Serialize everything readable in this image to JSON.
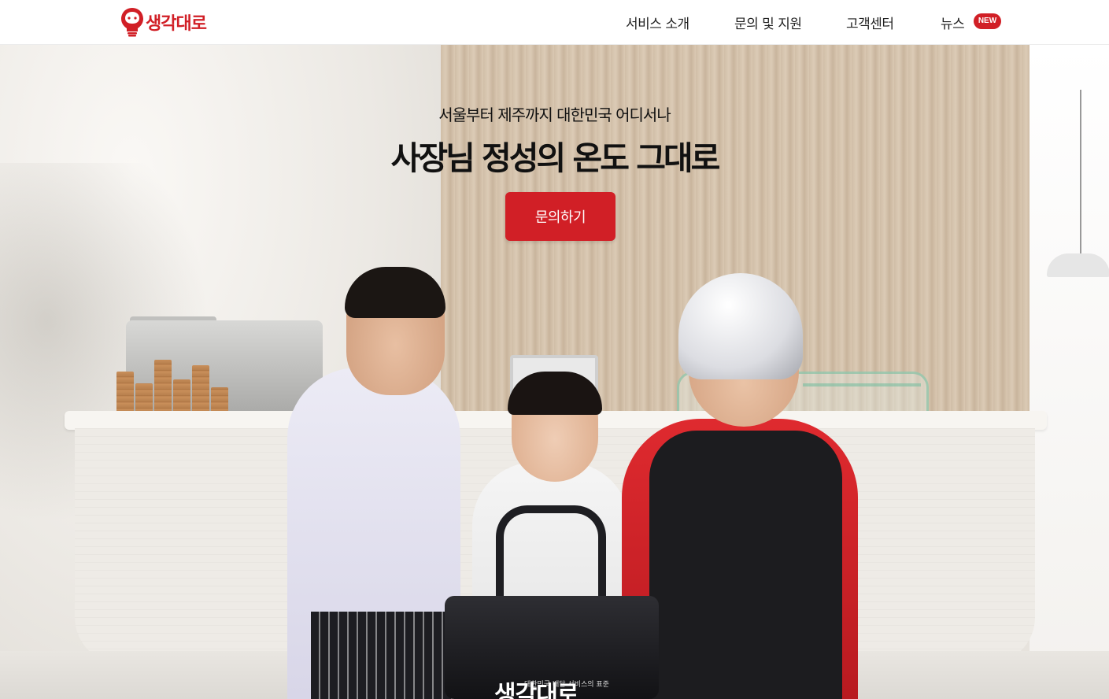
{
  "header": {
    "logo_text": "생각대로",
    "nav": [
      {
        "label": "서비스 소개"
      },
      {
        "label": "문의 및 지원"
      },
      {
        "label": "고객센터"
      },
      {
        "label": "뉴스"
      }
    ],
    "news_badge": "NEW"
  },
  "hero": {
    "subtitle": "서울부터 제주까지 대한민국 어디서나",
    "title": "사장님 정성의 온도 그대로",
    "cta_label": "문의하기",
    "bag_logo_text": "생각대로",
    "bag_tagline": "대한민국 배달 서비스의 표준"
  },
  "colors": {
    "brand_red": "#d11f26",
    "text_dark": "#111111",
    "background": "#ffffff"
  },
  "icons": {
    "logo_mark": "lightbulb-face-icon"
  }
}
